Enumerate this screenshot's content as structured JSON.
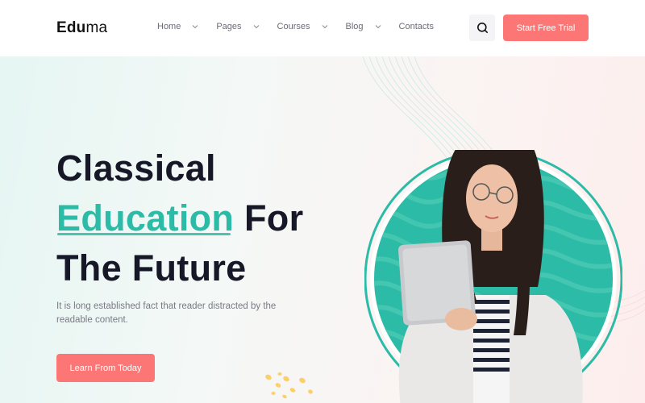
{
  "header": {
    "logo_bold": "Edu",
    "logo_regular": "ma",
    "nav": [
      {
        "label": "Home",
        "has_dropdown": true
      },
      {
        "label": "Pages",
        "has_dropdown": true
      },
      {
        "label": "Courses",
        "has_dropdown": true
      },
      {
        "label": "Blog",
        "has_dropdown": true
      },
      {
        "label": "Contacts",
        "has_dropdown": false
      }
    ],
    "search_icon": "search-icon",
    "cta_label": "Start Free Trial"
  },
  "hero": {
    "title_line1": "Classical",
    "title_accent": "Education",
    "title_line2_rest": " For",
    "title_line3": "The Future",
    "description": "It is long established fact that reader distracted by the readable content.",
    "button_label": "Learn From Today",
    "image_alt": "Smiling woman with glasses holding a laptop"
  },
  "colors": {
    "accent": "#2cbba6",
    "primary_button": "#fd7676",
    "heading": "#161827",
    "body_text": "#7a7a85",
    "dots": "#fbcf6a"
  }
}
